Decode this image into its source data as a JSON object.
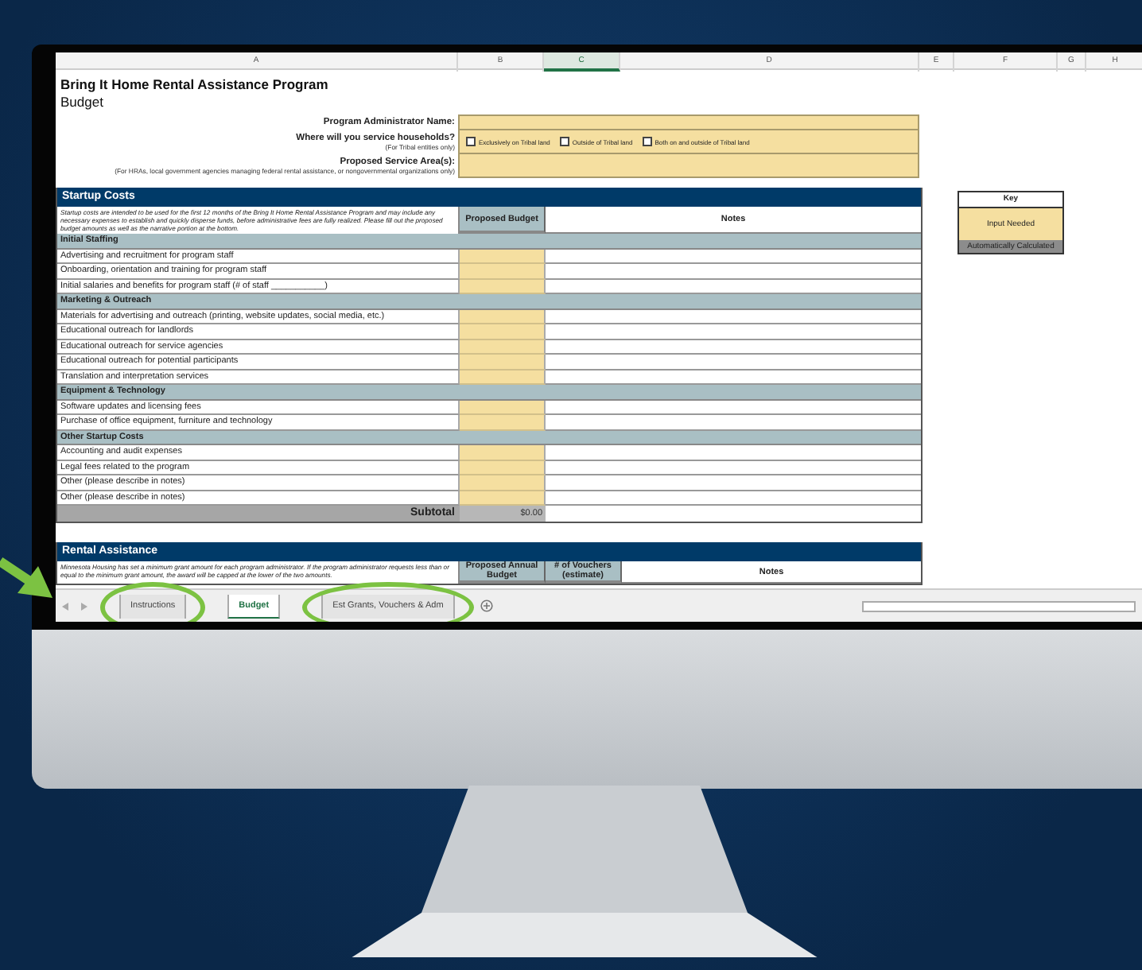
{
  "column_headers": [
    {
      "label": "A",
      "selected": false
    },
    {
      "label": "B",
      "selected": false
    },
    {
      "label": "C",
      "selected": true
    },
    {
      "label": "D",
      "selected": false
    },
    {
      "label": "E",
      "selected": false
    },
    {
      "label": "F",
      "selected": false
    },
    {
      "label": "G",
      "selected": false
    },
    {
      "label": "H",
      "selected": false
    }
  ],
  "title": "Bring It Home Rental Assistance Program",
  "subtitle": "Budget",
  "form_fields": [
    {
      "kind": "text",
      "label": "Program Administrator Name:"
    },
    {
      "kind": "checkboxes",
      "label": "Where will you service households?",
      "note": "(For Tribal entities only)",
      "options": [
        {
          "label": "Exclusively on Tribal land",
          "checked": false
        },
        {
          "label": "Outside of Tribal land",
          "checked": false
        },
        {
          "label": "Both on and outside of Tribal land",
          "checked": false
        }
      ]
    },
    {
      "kind": "text",
      "label": "Proposed Service Area(s):",
      "note": "(For HRAs, local government agencies managing federal rental assistance, or nongovernmental organizations only)"
    }
  ],
  "startup": {
    "title": "Startup Costs",
    "description": "Startup costs are intended to be used for the first 12 months of the Bring It Home Rental Assistance Program and may include any necessary expenses to establish and quickly disperse funds, before administrative fees are fully realized. Please fill out the proposed budget amounts as well as the narrative portion at the bottom.",
    "columns": [
      "Proposed Budget",
      "Notes"
    ],
    "groups": [
      {
        "title": "Initial Staffing",
        "items": [
          "Advertising and recruitment for program staff",
          "Onboarding, orientation and training for program staff",
          "Initial salaries and benefits for program staff (# of staff ___________)"
        ]
      },
      {
        "title": "Marketing & Outreach",
        "items": [
          "Materials for advertising and outreach (printing, website updates, social media, etc.)",
          "Educational outreach for landlords",
          "Educational outreach for service agencies",
          "Educational outreach for potential participants",
          "Translation and interpretation services"
        ]
      },
      {
        "title": "Equipment & Technology",
        "items": [
          "Software updates and licensing fees",
          "Purchase of office equipment, furniture and technology"
        ]
      },
      {
        "title": "Other Startup Costs",
        "items": [
          "Accounting and audit expenses",
          "Legal fees related to the program",
          "Other (please describe in notes)",
          "Other (please describe in notes)"
        ]
      }
    ],
    "subtotal": {
      "label": "Subtotal",
      "value": "$0.00"
    }
  },
  "key": {
    "title": "Key",
    "items": [
      {
        "kind": "input",
        "label": "Input Needed"
      },
      {
        "kind": "calculated",
        "label": "Automatically Calculated"
      }
    ]
  },
  "rental": {
    "title": "Rental Assistance",
    "description": "Minnesota Housing has set a minimum grant amount for each program administrator. If the program administrator requests less than or equal to the minimum grant amount, the award will be capped at the lower of the two amounts.",
    "columns": [
      "Proposed Annual Budget",
      "# of Vouchers (estimate)",
      "Notes"
    ]
  },
  "sheet_tabs": [
    {
      "label": "Instructions",
      "selected": false,
      "circled": true
    },
    {
      "label": "Budget",
      "selected": true,
      "circled": false
    },
    {
      "label": "Est Grants, Vouchers & Adm",
      "selected": false,
      "circled": true
    }
  ]
}
